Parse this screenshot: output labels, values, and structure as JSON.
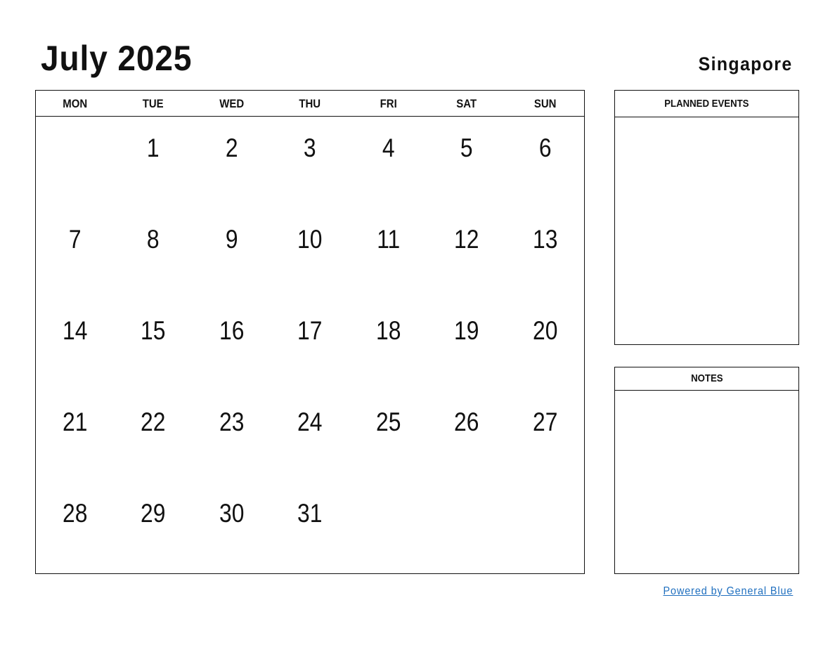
{
  "header": {
    "title": "July 2025",
    "country": "Singapore"
  },
  "calendar": {
    "weekdays": [
      "MON",
      "TUE",
      "WED",
      "THU",
      "FRI",
      "SAT",
      "SUN"
    ],
    "weeks": [
      [
        "",
        "1",
        "2",
        "3",
        "4",
        "5",
        "6"
      ],
      [
        "7",
        "8",
        "9",
        "10",
        "11",
        "12",
        "13"
      ],
      [
        "14",
        "15",
        "16",
        "17",
        "18",
        "19",
        "20"
      ],
      [
        "21",
        "22",
        "23",
        "24",
        "25",
        "26",
        "27"
      ],
      [
        "28",
        "29",
        "30",
        "31",
        "",
        "",
        ""
      ]
    ]
  },
  "panels": {
    "events_title": "PLANNED EVENTS",
    "notes_title": "NOTES"
  },
  "footer": {
    "link_text": "Powered by General Blue",
    "link_color": "#1f6fbf"
  }
}
